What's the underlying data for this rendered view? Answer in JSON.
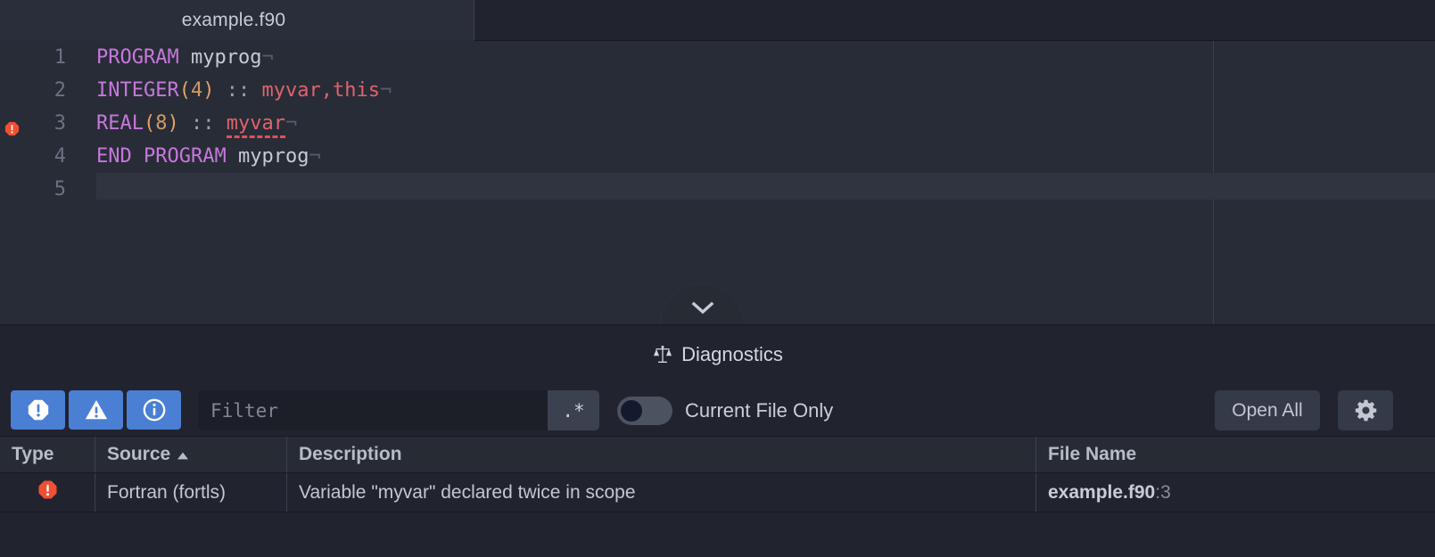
{
  "tab": {
    "label": "example.f90",
    "icon": "file-icon"
  },
  "editor": {
    "lines": [
      {
        "number": "1",
        "marker": null,
        "tokens": [
          {
            "t": "PROGRAM",
            "c": "kw"
          },
          {
            "t": " ",
            "c": "plain"
          },
          {
            "t": "myprog",
            "c": "plain"
          },
          {
            "t": "¬",
            "c": "eol"
          }
        ]
      },
      {
        "number": "2",
        "marker": null,
        "tokens": [
          {
            "t": "INTEGER",
            "c": "kw"
          },
          {
            "t": "(",
            "c": "punct"
          },
          {
            "t": "4",
            "c": "num"
          },
          {
            "t": ")",
            "c": "punct"
          },
          {
            "t": " ",
            "c": "plain"
          },
          {
            "t": "::",
            "c": "op"
          },
          {
            "t": " ",
            "c": "plain"
          },
          {
            "t": "myvar",
            "c": "id"
          },
          {
            "t": ",",
            "c": "id"
          },
          {
            "t": "this",
            "c": "id"
          },
          {
            "t": "¬",
            "c": "eol"
          }
        ]
      },
      {
        "number": "3",
        "marker": "error-icon",
        "tokens": [
          {
            "t": "REAL",
            "c": "kw"
          },
          {
            "t": "(",
            "c": "punct"
          },
          {
            "t": "8",
            "c": "num"
          },
          {
            "t": ")",
            "c": "punct"
          },
          {
            "t": " ",
            "c": "plain"
          },
          {
            "t": "::",
            "c": "op"
          },
          {
            "t": " ",
            "c": "plain"
          },
          {
            "t": "myvar",
            "c": "id",
            "underline": true
          },
          {
            "t": "¬",
            "c": "eol"
          }
        ]
      },
      {
        "number": "4",
        "marker": null,
        "tokens": [
          {
            "t": "END",
            "c": "kw"
          },
          {
            "t": " ",
            "c": "plain"
          },
          {
            "t": "PROGRAM",
            "c": "kw"
          },
          {
            "t": " ",
            "c": "plain"
          },
          {
            "t": "myprog",
            "c": "plain"
          },
          {
            "t": "¬",
            "c": "eol"
          }
        ]
      },
      {
        "number": "5",
        "marker": null,
        "current": true,
        "tokens": []
      }
    ]
  },
  "collapse_handle": {
    "icon": "chevron-down-icon"
  },
  "panel": {
    "title": "Diagnostics",
    "title_icon": "scales-icon",
    "toolbar": {
      "severity_buttons": [
        {
          "name": "error-filter-button",
          "icon": "error-octagon-icon",
          "active": true
        },
        {
          "name": "warning-filter-button",
          "icon": "warning-triangle-icon",
          "active": true
        },
        {
          "name": "info-filter-button",
          "icon": "info-circle-icon",
          "active": true
        }
      ],
      "filter": {
        "value": "",
        "placeholder": "Filter"
      },
      "regex_button": ".*",
      "current_file_only": {
        "label": "Current File Only",
        "on": false
      },
      "open_all_label": "Open All",
      "settings_icon": "gear-icon"
    },
    "table": {
      "columns": [
        {
          "label": "Type",
          "sort": null
        },
        {
          "label": "Source",
          "sort": "asc"
        },
        {
          "label": "Description",
          "sort": null
        },
        {
          "label": "File Name",
          "sort": null
        }
      ],
      "rows": [
        {
          "type_icon": "error-octagon-icon",
          "source": "Fortran (fortls)",
          "description": "Variable \"myvar\" declared twice in scope",
          "file_name": "example.f90",
          "file_line": ":3"
        }
      ]
    }
  },
  "colors": {
    "accent_blue": "#4a7fd4",
    "error_red": "#f04f32",
    "keyword_purple": "#c678dd",
    "identifier_red": "#e0636e",
    "number_orange": "#d19a66",
    "editor_bg": "#282c36",
    "panel_bg": "#21242e"
  }
}
